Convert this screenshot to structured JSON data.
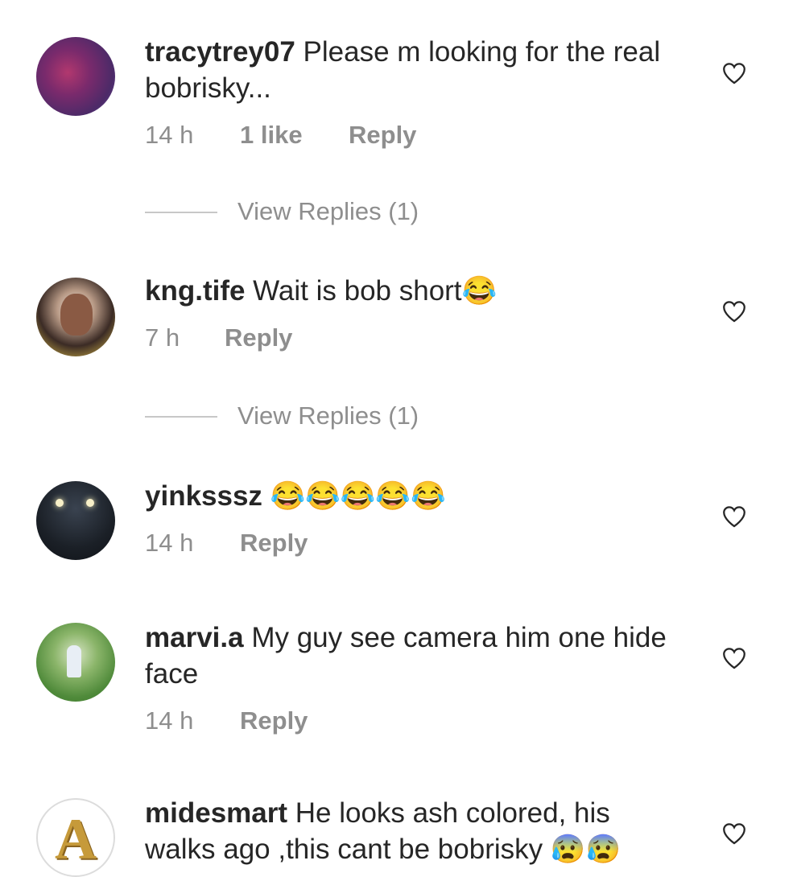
{
  "comments": [
    {
      "username": "tracytrey07",
      "text": " Please m looking for the real bobrisky...",
      "time": "14 h",
      "likes": "1 like",
      "reply": "Reply",
      "view_replies": "View Replies (1)"
    },
    {
      "username": "kng.tife",
      "text": " Wait is bob short😂",
      "time": "7 h",
      "reply": "Reply",
      "view_replies": "View Replies (1)"
    },
    {
      "username": "yinksssz",
      "text": " 😂😂😂😂😂",
      "time": "14 h",
      "reply": "Reply"
    },
    {
      "username": "marvi.a",
      "text": " My guy see camera him one hide face",
      "time": "14 h",
      "reply": "Reply"
    },
    {
      "username": "midesmart",
      "text": " He looks ash colored, his walks ago ,this cant be bobrisky 😰😰"
    }
  ],
  "avatar_letter": "A",
  "icons": {
    "like": "heart-outline-icon"
  },
  "colors": {
    "text": "#262626",
    "meta": "#8e8e8e",
    "divider": "#c7c7c7"
  }
}
